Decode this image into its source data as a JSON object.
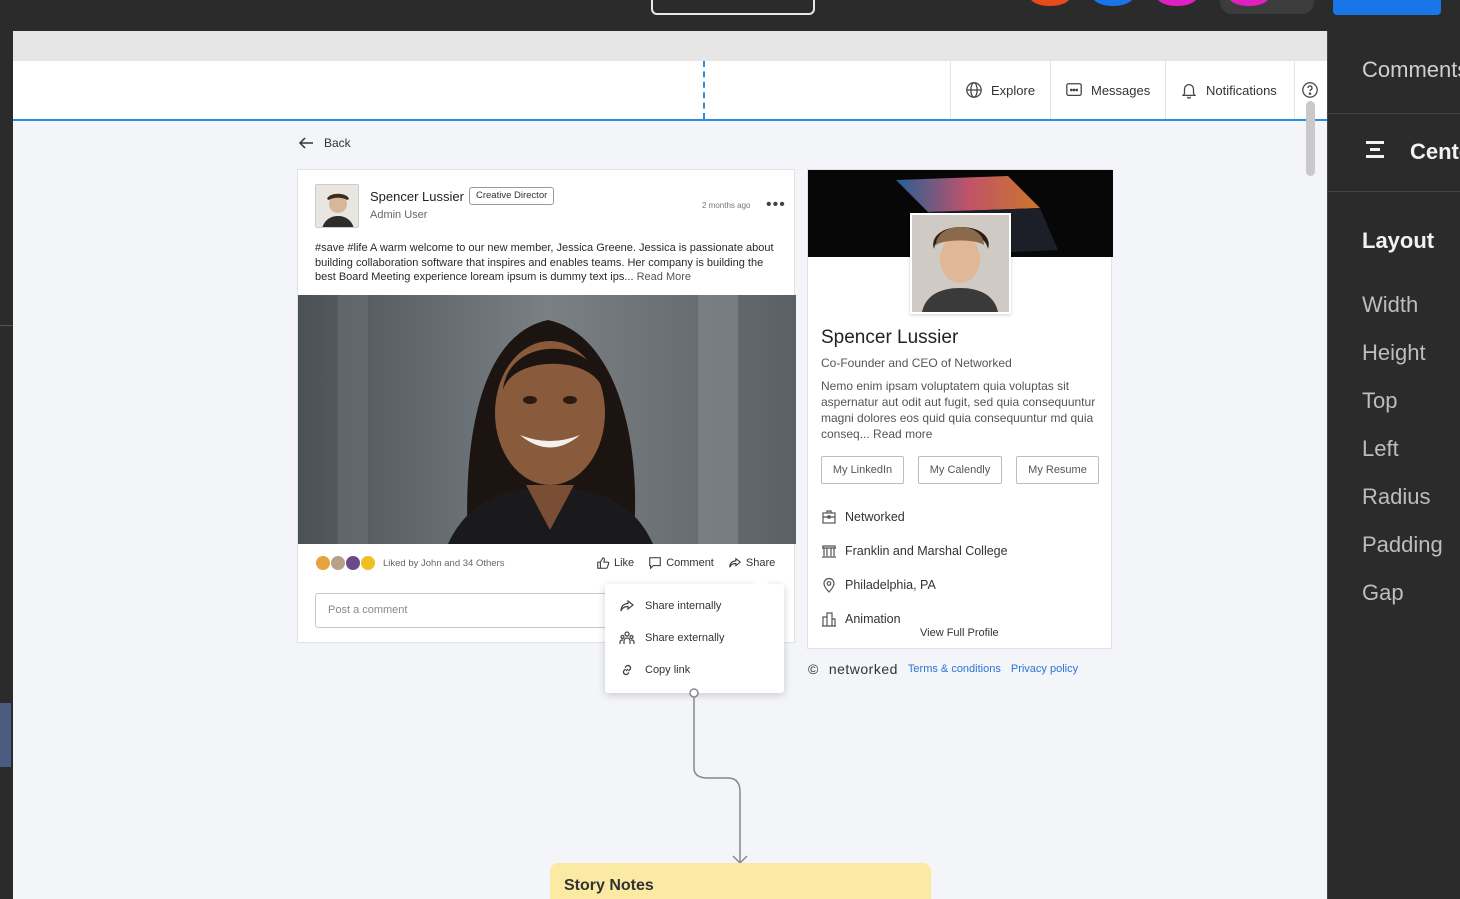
{
  "nav": {
    "explore": "Explore",
    "messages": "Messages",
    "notifications": "Notifications"
  },
  "back_label": "Back",
  "post": {
    "author": "Spencer Lussier",
    "badge": "Creative Director",
    "role": "Admin User",
    "time": "2 months ago",
    "body": "#save #life A warm welcome to our new member, Jessica Greene. Jessica is passionate about building collaboration software that inspires and enables teams. Her company is building the best Board Meeting experience loream ipsum is dummy text ips...",
    "read_more": "Read More",
    "liked_by": "Liked by John and 34 Others",
    "like": "Like",
    "comment": "Comment",
    "share": "Share",
    "comment_placeholder": "Post a comment"
  },
  "share_menu": {
    "internal": "Share internally",
    "external": "Share externally",
    "copy": "Copy link"
  },
  "profile": {
    "name": "Spencer Lussier",
    "title": "Co-Founder and CEO of Networked",
    "bio": "Nemo enim ipsam voluptatem quia voluptas sit aspernatur aut odit aut fugit, sed quia consequuntur magni dolores eos quid quia consequuntur md quia conseq...",
    "read_more": "Read more",
    "btn_linkedin": "My LinkedIn",
    "btn_calendly": "My Calendly",
    "btn_resume": "My Resume",
    "company": "Networked",
    "college": "Franklin and Marshal College",
    "location": "Philadelphia, PA",
    "industry": "Animation",
    "view_full": "View Full Profile"
  },
  "footer": {
    "copyright": "©",
    "brand": "networked",
    "terms": "Terms & conditions",
    "privacy": "Privacy policy"
  },
  "story_notes": "Story Notes",
  "right_panel": {
    "comments": "Comments",
    "align": "Center",
    "layout": "Layout",
    "props": [
      "Width",
      "Height",
      "Top",
      "Left",
      "Radius",
      "Padding",
      "Gap"
    ]
  },
  "colors": {
    "accent": "#2b8fe0",
    "link": "#2b73d6",
    "notes": "#fbeaa3"
  }
}
